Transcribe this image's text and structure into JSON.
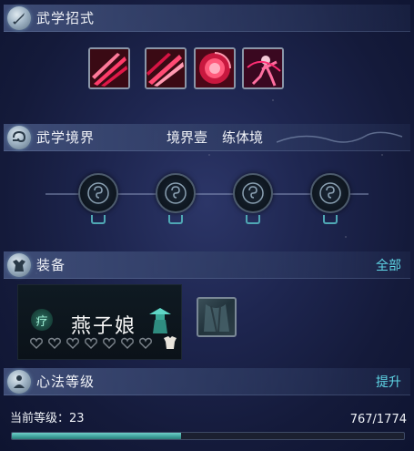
{
  "sections": {
    "skills": {
      "title": "武学招式",
      "icon": "sword-icon"
    },
    "realm": {
      "title": "武学境界",
      "realm_name": "境界壹",
      "realm_level": "练体境",
      "icon": "swirl-icon"
    },
    "equipment": {
      "title": "装备",
      "action": "全部",
      "icon": "armor-icon"
    },
    "mind": {
      "title": "心法等级",
      "action": "提升",
      "icon": "meditation-icon"
    }
  },
  "skills": [
    {
      "name": "slash-skill-1-icon",
      "color": "#e0204a"
    },
    {
      "name": "slash-skill-2-icon",
      "color": "#e0204a"
    },
    {
      "name": "rose-swirl-skill-icon",
      "color": "#c8183f"
    },
    {
      "name": "dancer-skill-icon",
      "color": "#d01a6a"
    }
  ],
  "realm_nodes": [
    {
      "state": "locked",
      "icon": "swirl-icon"
    },
    {
      "state": "locked",
      "icon": "swirl-icon"
    },
    {
      "state": "locked",
      "icon": "swirl-icon"
    },
    {
      "state": "locked",
      "icon": "swirl-icon"
    }
  ],
  "equipment": {
    "name": "燕子娘",
    "badge": "疗",
    "hearts_total": 7,
    "hearts_filled": 0,
    "figure_icon": "straw-hat-figure-icon",
    "corner_icon": "cloth-icon",
    "slot_icon": "robe-slot-icon"
  },
  "level": {
    "label": "当前等级：23",
    "current": 767,
    "max": 1774,
    "progress_text": "767/1774"
  },
  "colors": {
    "accent": "#5fd6e6",
    "bar_fill": "#4fb3ad"
  }
}
